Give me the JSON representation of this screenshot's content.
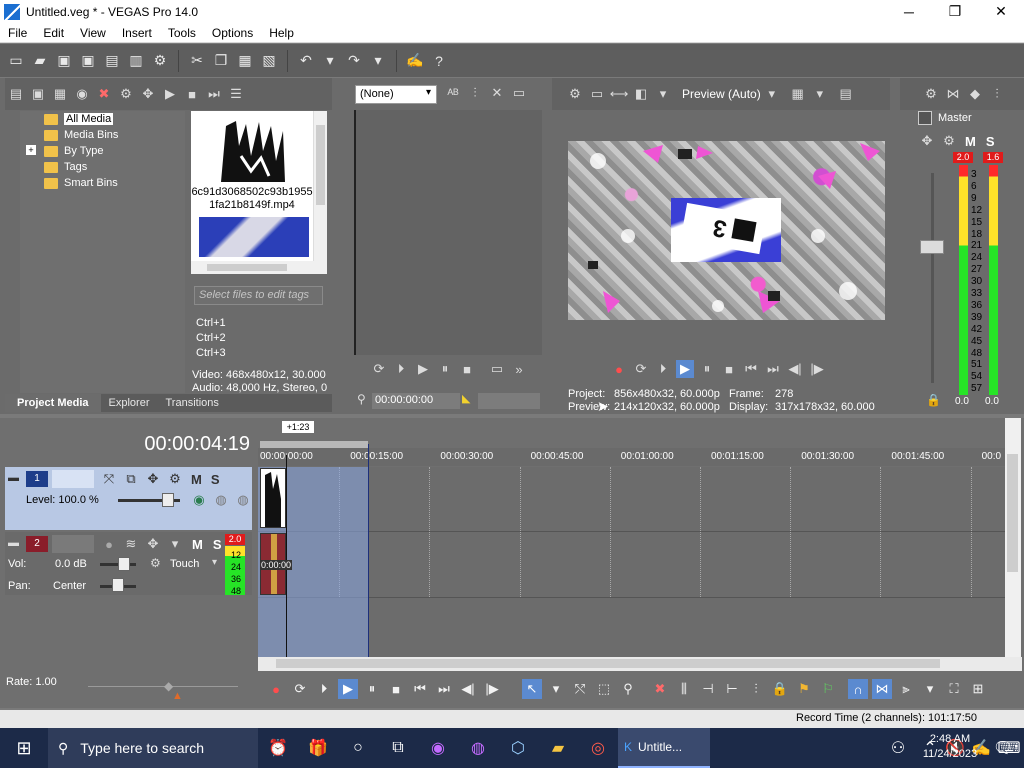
{
  "window": {
    "title": "Untitled.veg * - VEGAS Pro 14.0",
    "minimize": "─",
    "maximize": "❐",
    "close": "✕"
  },
  "menu": [
    "File",
    "Edit",
    "View",
    "Insert",
    "Tools",
    "Options",
    "Help"
  ],
  "project_media": {
    "tree": [
      "All Media",
      "Media Bins",
      "By Type",
      "Tags",
      "Smart Bins"
    ],
    "expander": "+",
    "file1_name": "6c91d3068502c93b1955 1fa21b8149f.mp4",
    "tag_placeholder": "Select files to edit tags",
    "shortcuts": [
      "Ctrl+1",
      "Ctrl+2",
      "Ctrl+3"
    ],
    "video_info": "Video: 468x480x12, 30.000",
    "audio_info": "Audio: 48,000 Hz, Stereo, 0(",
    "tabs": [
      "Project Media",
      "Explorer",
      "Transitions"
    ]
  },
  "trimmer": {
    "select_value": "(None)",
    "time": "00:00:00:00"
  },
  "preview": {
    "mode": "Preview (Auto)",
    "project_label": "Project:",
    "project_value": "856x480x32, 60.000p",
    "preview_label": "Preview:",
    "preview_value": "214x120x32, 60.000p",
    "frame_label": "Frame:",
    "frame_value": "278",
    "display_label": "Display:",
    "display_value": "317x178x32, 60.000"
  },
  "master": {
    "label": "Master",
    "m": "M",
    "s": "S",
    "peak_left": "2.0",
    "peak_right": "1.6",
    "scale": [
      "3",
      "6",
      "9",
      "12",
      "15",
      "18",
      "21",
      "24",
      "27",
      "30",
      "33",
      "36",
      "39",
      "42",
      "45",
      "48",
      "51",
      "54",
      "57"
    ],
    "bottom_left": "0.0",
    "bottom_right": "0.0"
  },
  "timeline": {
    "time": "00:00:04:19",
    "marker": "+1:23",
    "ruler": [
      "00:00:00:00",
      "00:00:15:00",
      "00:00:30:00",
      "00:00:45:00",
      "00:01:00:00",
      "00:01:15:00",
      "00:01:30:00",
      "00:01:45:00",
      "00:0"
    ],
    "track1": {
      "num": "1",
      "level": "Level: 100.0 %",
      "m": "M",
      "s": "S"
    },
    "track2": {
      "num": "2",
      "vol_label": "Vol:",
      "vol_value": "0.0 dB",
      "pan_label": "Pan:",
      "pan_value": "Center",
      "touch": "Touch",
      "m": "M",
      "s": "S",
      "peak": "2.0",
      "meter_scale": [
        "12",
        "24",
        "36",
        "48"
      ],
      "clip_time": "0:00:00"
    },
    "rate": "Rate: 1.00",
    "record_time": "Record Time (2 channels): 101:17:50"
  },
  "taskbar": {
    "search_placeholder": "Type here to search",
    "vegas_task": "Untitle...",
    "time": "2:48 AM",
    "date": "11/24/2023"
  }
}
